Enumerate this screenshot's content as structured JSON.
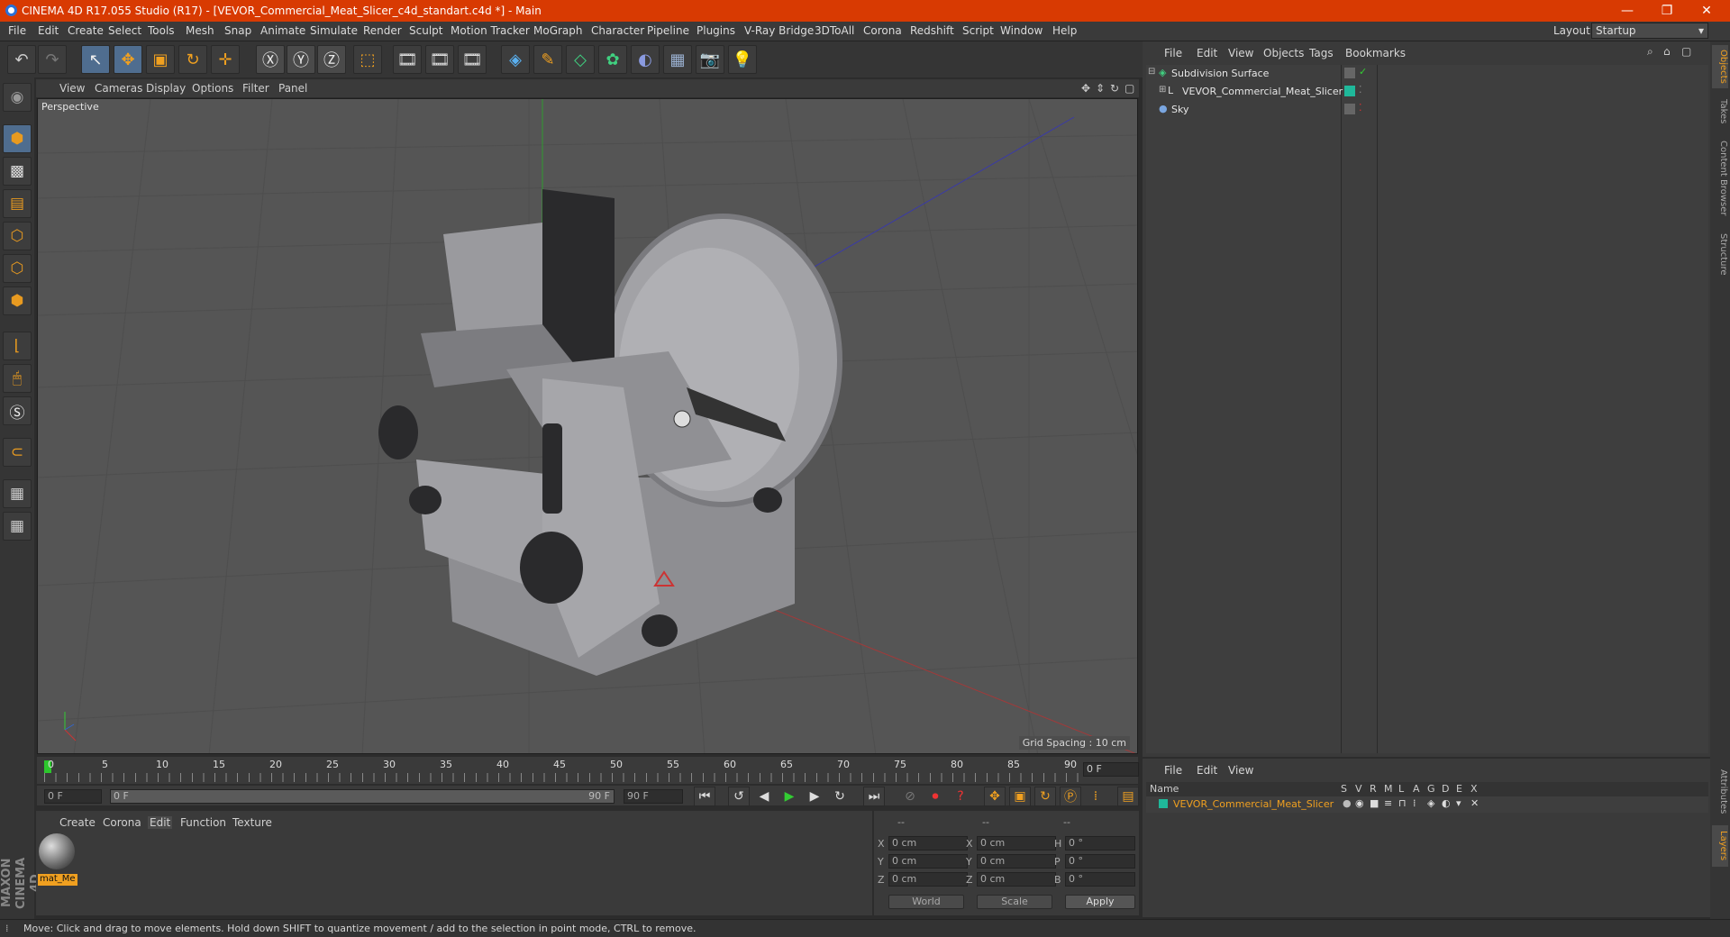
{
  "window": {
    "title": "CINEMA 4D R17.055 Studio (R17) - [VEVOR_Commercial_Meat_Slicer_c4d_standart.c4d *] - Main",
    "min": "—",
    "max": "❐",
    "close": "✕"
  },
  "menu": [
    "File",
    "Edit",
    "Create",
    "Select",
    "Tools",
    "Mesh",
    "Snap",
    "Animate",
    "Simulate",
    "Render",
    "Sculpt",
    "Motion Tracker",
    "MoGraph",
    "Character",
    "Pipeline",
    "Plugins",
    "V-Ray Bridge",
    "3DToAll",
    "Corona",
    "Redshift",
    "Script",
    "Window",
    "Help"
  ],
  "layout": {
    "label": "Layout:",
    "value": "Startup"
  },
  "viewport": {
    "menu": [
      "View",
      "Cameras",
      "Display",
      "Options",
      "Filter",
      "Panel"
    ],
    "label": "Perspective",
    "grid_spacing": "Grid Spacing : 10 cm"
  },
  "timeline": {
    "ticks": [
      "0",
      "5",
      "10",
      "15",
      "20",
      "25",
      "30",
      "35",
      "40",
      "45",
      "50",
      "55",
      "60",
      "65",
      "70",
      "75",
      "80",
      "85",
      "90"
    ],
    "current_frame": "0 F",
    "start": "0 F",
    "range_start": "0 F",
    "range_end": "90 F",
    "end": "90 F"
  },
  "material_manager": {
    "tabs": [
      "Create",
      "Corona",
      "Edit",
      "Function",
      "Texture"
    ],
    "material_name": "mat_Me"
  },
  "coordinates": {
    "headers": [
      "--",
      "--",
      "--"
    ],
    "rows": [
      {
        "a": "X",
        "av": "0 cm",
        "b": "X",
        "bv": "0 cm",
        "c": "H",
        "cv": "0 °"
      },
      {
        "a": "Y",
        "av": "0 cm",
        "b": "Y",
        "bv": "0 cm",
        "c": "P",
        "cv": "0 °"
      },
      {
        "a": "Z",
        "av": "0 cm",
        "b": "Z",
        "bv": "0 cm",
        "c": "B",
        "cv": "0 °"
      }
    ],
    "world": "World",
    "scale": "Scale",
    "apply": "Apply"
  },
  "object_manager": {
    "menu": [
      "File",
      "Edit",
      "View",
      "Objects",
      "Tags",
      "Bookmarks"
    ],
    "objects": [
      {
        "name": "Subdivision Surface"
      },
      {
        "name": "VEVOR_Commercial_Meat_Slicer"
      },
      {
        "name": "Sky"
      }
    ]
  },
  "right_tabs": [
    "Objects",
    "Takes",
    "Content Browser",
    "Structure",
    "Attributes",
    "Layers"
  ],
  "layer_manager": {
    "menu": [
      "File",
      "Edit",
      "View"
    ],
    "columns": [
      "Name",
      "S",
      "V",
      "R",
      "M",
      "L",
      "A",
      "G",
      "D",
      "E",
      "X"
    ],
    "layer_name": "VEVOR_Commercial_Meat_Slicer"
  },
  "status": "Move: Click and drag to move elements. Hold down SHIFT to quantize movement / add to the selection in point mode, CTRL to remove.",
  "logo_text": "MAXON CINEMA 4D",
  "colors": {
    "title_bar": "#d83a02",
    "accent": "#f0a020",
    "layer_color": "#1fb89a"
  }
}
